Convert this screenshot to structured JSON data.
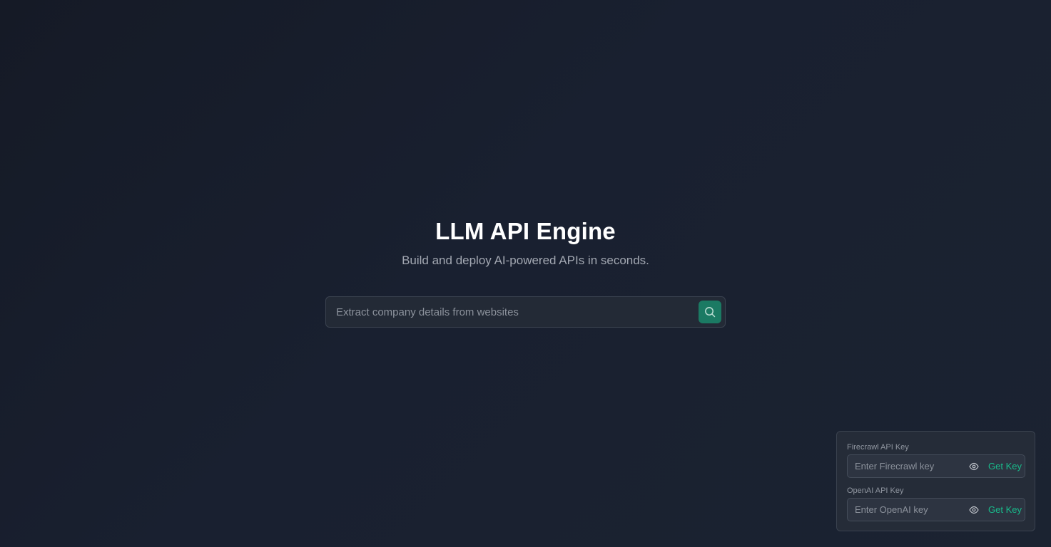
{
  "hero": {
    "title": "LLM API Engine",
    "subtitle": "Build and deploy AI-powered APIs in seconds."
  },
  "search": {
    "placeholder": "Extract company details from websites",
    "value": "",
    "button_icon": "search-icon"
  },
  "api_keys": {
    "firecrawl": {
      "label": "Firecrawl API Key",
      "placeholder": "Enter Firecrawl key",
      "toggle_icon": "eye-icon",
      "link_label": "Get Key"
    },
    "openai": {
      "label": "OpenAI API Key",
      "placeholder": "Enter OpenAI key",
      "toggle_icon": "eye-icon",
      "link_label": "Get Key"
    }
  },
  "colors": {
    "background": "#171d2a",
    "accent": "#19b98a",
    "search_button": "#1b7a63",
    "panel": "#252c38"
  }
}
